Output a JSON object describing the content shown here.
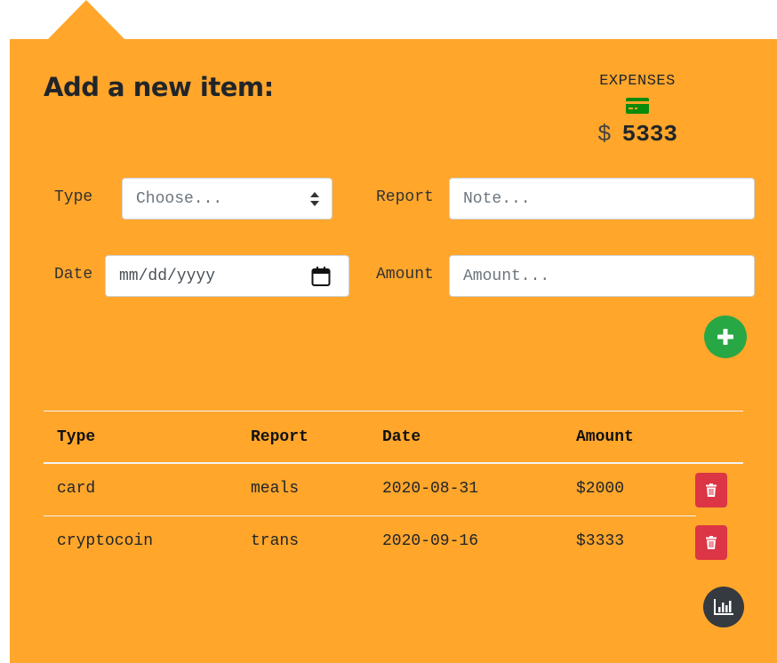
{
  "form": {
    "title": "Add a new item:",
    "type_label": "Type",
    "type_selected": "Choose...",
    "report_label": "Report",
    "report_placeholder": "Note...",
    "date_label": "Date",
    "date_placeholder": "mm/dd/yyyy",
    "amount_label": "Amount",
    "amount_placeholder": "Amount..."
  },
  "summary": {
    "label": "EXPENSES",
    "currency": "$",
    "amount": "5333",
    "icon": "credit-card-icon",
    "icon_color": "#0a8a0a"
  },
  "table": {
    "headers": [
      "Type",
      "Report",
      "Date",
      "Amount"
    ],
    "rows": [
      {
        "type": "card",
        "report": "meals",
        "date": "2020-08-31",
        "amount": "$2000"
      },
      {
        "type": "cryptocoin",
        "report": "trans",
        "date": "2020-09-16",
        "amount": "$3333"
      }
    ]
  },
  "colors": {
    "panel": "#ffa62b",
    "add_button": "#28a745",
    "delete_button": "#dc3545",
    "chart_button": "#343a40"
  }
}
